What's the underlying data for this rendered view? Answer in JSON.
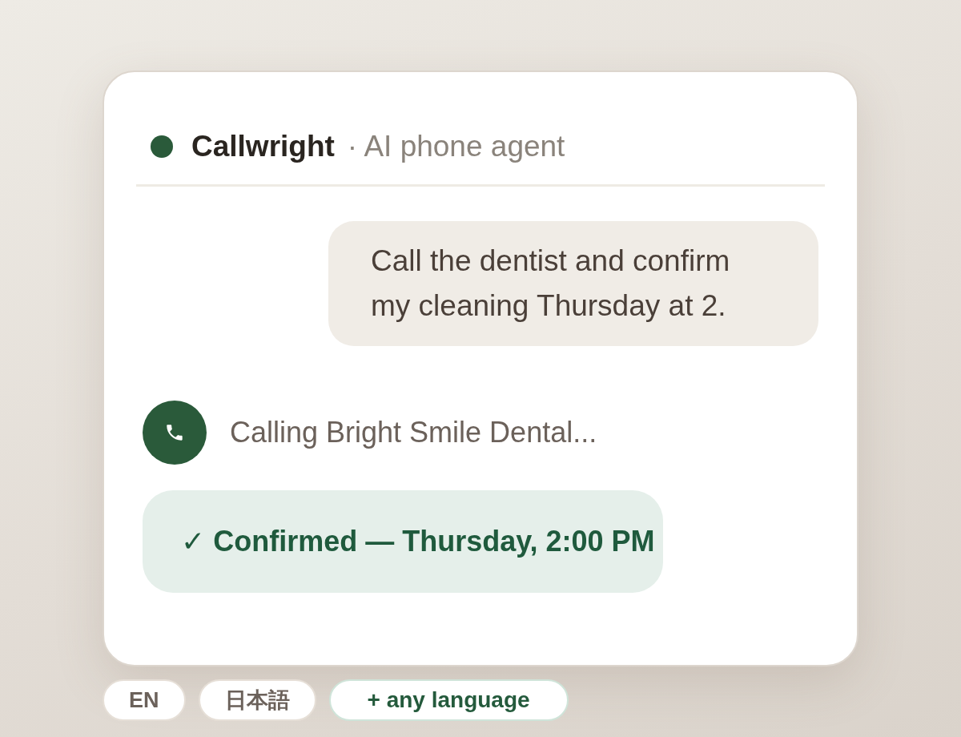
{
  "header": {
    "name": "Callwright",
    "tagline": "· AI phone agent"
  },
  "messages": [
    {
      "kind": "user",
      "text": "Call the dentist and confirm my cleaning Thursday at 2."
    },
    {
      "kind": "status",
      "text": "Calling Bright Smile Dental..."
    },
    {
      "kind": "result",
      "text": "✓ Confirmed — Thursday, 2:00 PM"
    }
  ],
  "languages": [
    {
      "kind": "lang",
      "label": "EN"
    },
    {
      "kind": "lang",
      "label": "日本語"
    },
    {
      "kind": "more",
      "label": "+ any language"
    }
  ]
}
